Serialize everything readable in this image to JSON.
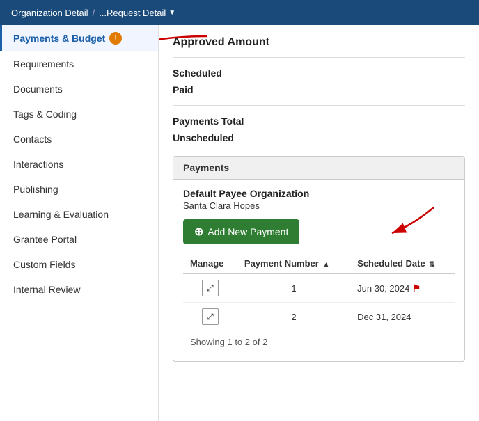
{
  "header": {
    "breadcrumb_start": "Organization Detail",
    "separator": "/",
    "breadcrumb_end": "...Request Detail",
    "chevron": "▼"
  },
  "sidebar": {
    "items": [
      {
        "id": "payments-budget",
        "label": "Payments & Budget",
        "active": true,
        "alert": true,
        "alert_symbol": "!"
      },
      {
        "id": "requirements",
        "label": "Requirements",
        "active": false
      },
      {
        "id": "documents",
        "label": "Documents",
        "active": false
      },
      {
        "id": "tags-coding",
        "label": "Tags & Coding",
        "active": false
      },
      {
        "id": "contacts",
        "label": "Contacts",
        "active": false
      },
      {
        "id": "interactions",
        "label": "Interactions",
        "active": false
      },
      {
        "id": "publishing",
        "label": "Publishing",
        "active": false
      },
      {
        "id": "learning-evaluation",
        "label": "Learning & Evaluation",
        "active": false
      },
      {
        "id": "grantee-portal",
        "label": "Grantee Portal",
        "active": false
      },
      {
        "id": "custom-fields",
        "label": "Custom Fields",
        "active": false
      },
      {
        "id": "internal-review",
        "label": "Internal Review",
        "active": false
      }
    ]
  },
  "main": {
    "approved_amount_label": "Approved Amount",
    "scheduled_label": "Scheduled",
    "paid_label": "Paid",
    "payments_total_label": "Payments Total",
    "unscheduled_label": "Unscheduled",
    "payments_section": {
      "header": "Payments",
      "default_payee_label": "Default Payee Organization",
      "org_name": "Santa Clara Hopes",
      "add_button_label": "Add New Payment",
      "add_button_plus": "⊕",
      "table": {
        "columns": [
          {
            "id": "manage",
            "label": "Manage"
          },
          {
            "id": "payment-number",
            "label": "Payment Number",
            "sortable": true,
            "sort_dir": "asc"
          },
          {
            "id": "scheduled-date",
            "label": "Scheduled Date",
            "sortable": true
          }
        ],
        "rows": [
          {
            "manage_icon": "⤢",
            "payment_number": "1",
            "scheduled_date": "Jun 30, 2024",
            "flag": true
          },
          {
            "manage_icon": "⤢",
            "payment_number": "2",
            "scheduled_date": "Dec 31, 2024",
            "flag": false
          }
        ],
        "showing_text": "Showing 1 to 2 of 2"
      }
    }
  }
}
